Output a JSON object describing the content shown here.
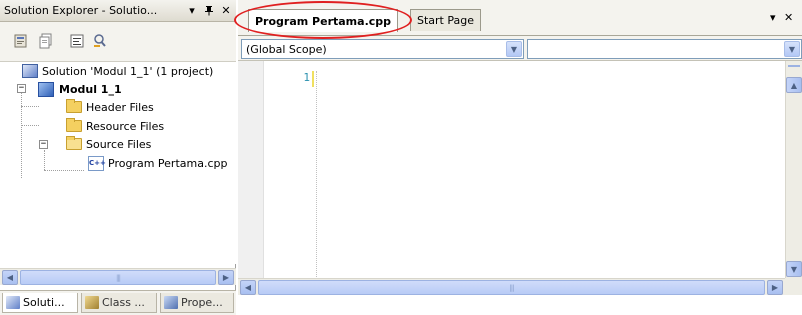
{
  "solution_explorer": {
    "title": "Solution Explorer - Solutio...",
    "dropdown_glyph": "▾",
    "pin_glyph": "ᵖ",
    "close_glyph": "✕",
    "toolbar_buttons": [
      "properties-icon",
      "show-all-files-icon",
      "view-code-icon",
      "class-view-icon"
    ],
    "tree": {
      "solution": "Solution 'Modul 1_1' (1 project)",
      "project": "Modul 1_1",
      "header_files": "Header Files",
      "resource_files": "Resource Files",
      "source_files": "Source Files",
      "source_file": "Program Pertama.cpp",
      "collapse_glyph": "−"
    },
    "bottom_tabs": [
      {
        "label": "Soluti...",
        "active": true
      },
      {
        "label": "Class ...",
        "active": false
      },
      {
        "label": "Prope...",
        "active": false
      }
    ]
  },
  "editor": {
    "tabs": [
      {
        "label": "Program Pertama.cpp",
        "active": true,
        "highlighted": true
      },
      {
        "label": "Start Page",
        "active": false
      }
    ],
    "window_menu_glyph": "▾",
    "close_glyph": "✕",
    "scope_combo": {
      "value": "(Global Scope)"
    },
    "member_combo": {
      "value": ""
    },
    "line_numbers": [
      "1"
    ]
  },
  "colors": {
    "highlight_ring": "#e02020",
    "line_number": "#2b91af",
    "panel_background": "#f4f3ee",
    "scroll_accent": "#b3c8f5"
  }
}
